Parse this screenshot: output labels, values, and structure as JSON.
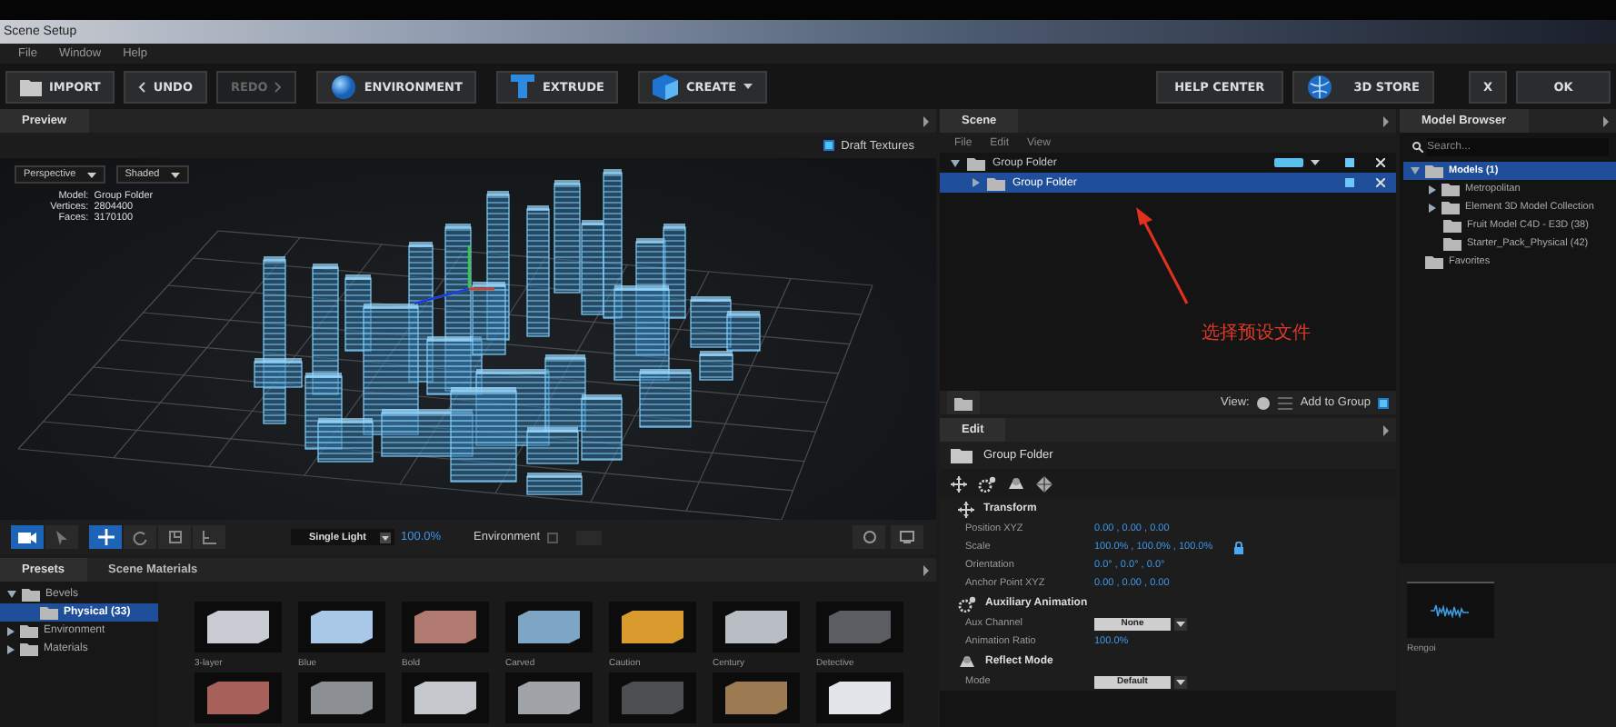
{
  "window": {
    "title": "Scene Setup"
  },
  "menu": [
    "File",
    "Window",
    "Help"
  ],
  "toolbar": [
    {
      "label": "IMPORT",
      "kind": "import",
      "disabled": false
    },
    {
      "label": "UNDO",
      "kind": "undo",
      "disabled": false
    },
    {
      "label": "REDO",
      "kind": "redo",
      "disabled": true
    },
    {
      "label": "ENVIRONMENT",
      "kind": "environment",
      "disabled": false
    },
    {
      "label": "EXTRUDE",
      "kind": "extrude",
      "disabled": false
    },
    {
      "label": "CREATE",
      "kind": "create",
      "disabled": false
    }
  ],
  "toolbar_right": [
    {
      "label": "HELP CENTER",
      "kind": "plain"
    },
    {
      "label": "3D STORE",
      "kind": "store"
    },
    {
      "label": "X",
      "kind": "plain"
    },
    {
      "label": "OK",
      "kind": "plain"
    }
  ],
  "preview": {
    "title": "Preview",
    "draft_textures": {
      "label": "Draft Textures",
      "checked": true
    },
    "view_mode": "Perspective",
    "shading": "Shaded",
    "info": [
      {
        "label": "Model:",
        "value": "Group Folder"
      },
      {
        "label": "Vertices:",
        "value": "2804400"
      },
      {
        "label": "Faces:",
        "value": "3170100"
      }
    ],
    "tools": [
      {
        "kind": "camera",
        "selected": true
      },
      {
        "kind": "pointer",
        "selected": false
      },
      {
        "kind": "move",
        "selected": true
      },
      {
        "kind": "rotate",
        "selected": false
      },
      {
        "kind": "scale",
        "selected": false
      },
      {
        "kind": "axis",
        "selected": false
      }
    ],
    "light": "Single Light",
    "light_level": "100.0%",
    "environment": {
      "label": "Environment",
      "checked": false
    }
  },
  "presets": {
    "tabs": [
      {
        "label": "Presets",
        "selected": true
      },
      {
        "label": "Scene Materials",
        "selected": false
      }
    ],
    "tree": [
      {
        "label": "Bevels",
        "expanded": true,
        "selected": false,
        "children": [
          {
            "label": "Physical (33)",
            "selected": true
          }
        ]
      },
      {
        "label": "Environment",
        "expanded": false,
        "selected": false
      },
      {
        "label": "Materials",
        "expanded": false,
        "selected": false
      }
    ],
    "materials": [
      {
        "label": "3-layer",
        "color": "#c8ccd2"
      },
      {
        "label": "Blue",
        "color": "#a9c8e8"
      },
      {
        "label": "Bold",
        "color": "#b07a70"
      },
      {
        "label": "Carved",
        "color": "#7ea6c4"
      },
      {
        "label": "Caution",
        "color": "#d99a2e"
      },
      {
        "label": "Century",
        "color": "#b9bec4"
      },
      {
        "label": "Detective",
        "color": "#5a5e62"
      },
      {
        "color": "#a8605a"
      },
      {
        "color": "#8c9094"
      },
      {
        "color": "#c4c8cc"
      },
      {
        "color": "#a0a4a8"
      },
      {
        "color": "#4c4e50"
      },
      {
        "color": "#9c7a52"
      },
      {
        "color": "#e2e6ea"
      }
    ]
  },
  "scene": {
    "title": "Scene",
    "menu": [
      "File",
      "Edit",
      "View"
    ],
    "tree": [
      {
        "label": "Group Folder",
        "expanded": true,
        "selected": false,
        "layer_toggle": true,
        "visible": true,
        "children": [
          {
            "label": "Group Folder",
            "expanded": false,
            "selected": true,
            "layer_toggle": false,
            "visible": true
          }
        ]
      }
    ],
    "annotation": "选择预设文件",
    "view_label": "View:",
    "add_to_group": {
      "label": "Add to Group",
      "checked": true
    }
  },
  "edit": {
    "title": "Edit",
    "object": "Group Folder",
    "sections": [
      {
        "title": "Transform",
        "kind": "transform",
        "rows": [
          {
            "label": "Position XYZ",
            "value": "0.00 ,  0.00 ,  0.00",
            "kind": "value"
          },
          {
            "label": "Scale",
            "value": "100.0% ,  100.0% ,  100.0%",
            "kind": "value",
            "locked": true
          },
          {
            "label": "Orientation",
            "value": "0.0° ,  0.0° ,  0.0°",
            "kind": "value"
          },
          {
            "label": "Anchor Point XYZ",
            "value": "0.00 ,  0.00 ,  0.00",
            "kind": "value"
          }
        ]
      },
      {
        "title": "Auxiliary Animation",
        "kind": "auxiliary",
        "rows": [
          {
            "label": "Aux Channel",
            "value": "None",
            "kind": "dropdown"
          },
          {
            "label": "Animation Ratio",
            "value": "100.0%",
            "kind": "value"
          }
        ]
      },
      {
        "title": "Reflect Mode",
        "kind": "reflect",
        "rows": [
          {
            "label": "Mode",
            "value": "Default",
            "kind": "dropdown"
          }
        ]
      }
    ]
  },
  "model_browser": {
    "title": "Model Browser",
    "search": {
      "placeholder": "Search..."
    },
    "tree": [
      {
        "label": "Models (1)",
        "expanded": true,
        "selected": true,
        "children": [
          {
            "label": "Metropolitan",
            "expanded": false,
            "selected": false
          },
          {
            "label": "Element 3D Model Collection",
            "expanded": false,
            "selected": false
          },
          {
            "label": "Fruit Model C4D - E3D (38)",
            "selected": false
          },
          {
            "label": "Starter_Pack_Physical (42)",
            "selected": false
          }
        ]
      },
      {
        "label": "Favorites",
        "selected": false
      }
    ],
    "thumbnail": {
      "label": "Rengoi"
    }
  }
}
